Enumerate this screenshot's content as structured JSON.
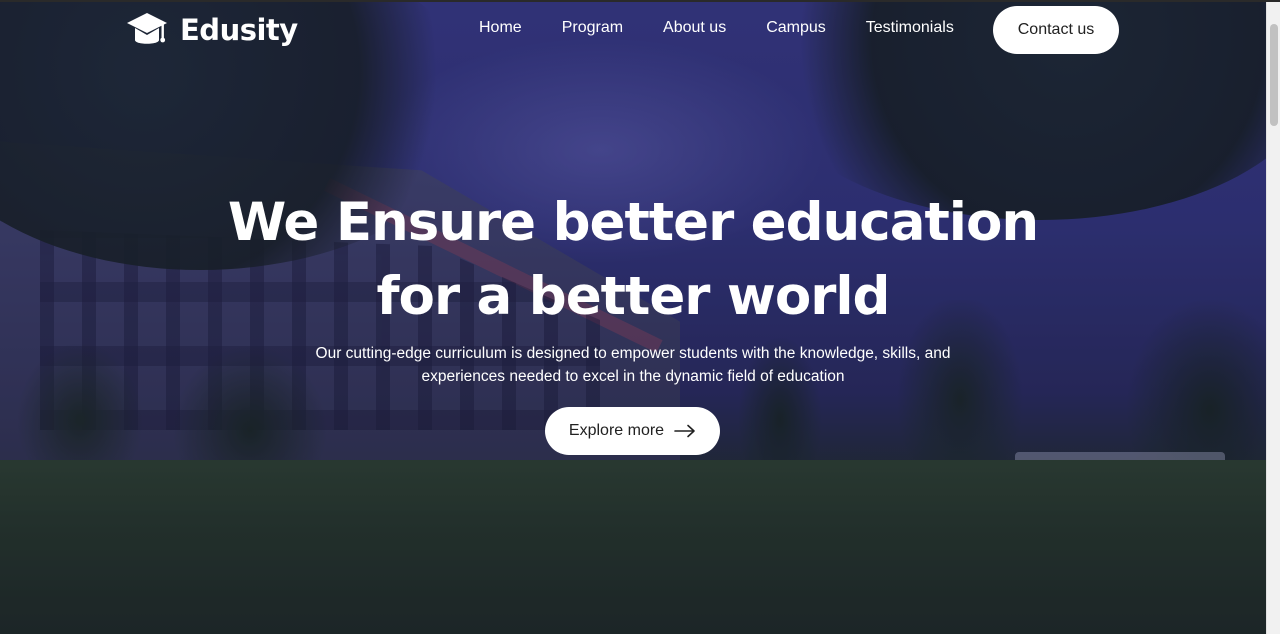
{
  "brand": {
    "name": "Edusity",
    "icon": "graduation-cap-icon"
  },
  "nav": {
    "items": [
      {
        "label": "Home"
      },
      {
        "label": "Program"
      },
      {
        "label": "About us"
      },
      {
        "label": "Campus"
      },
      {
        "label": "Testimonials"
      }
    ],
    "cta_label": "Contact us"
  },
  "hero": {
    "headline_line1": "We Ensure better education",
    "headline_line2": "for a better world",
    "subtext_line1": "Our cutting-edge curriculum is designed to empower students with the knowledge, skills, and",
    "subtext_line2": "experiences needed to excel in the dynamic field of education",
    "button_label": "Explore more",
    "button_icon": "arrow-right-icon"
  },
  "colors": {
    "overlay": "#181850",
    "text": "#ffffff",
    "button_bg": "#ffffff",
    "button_text": "#212121"
  }
}
